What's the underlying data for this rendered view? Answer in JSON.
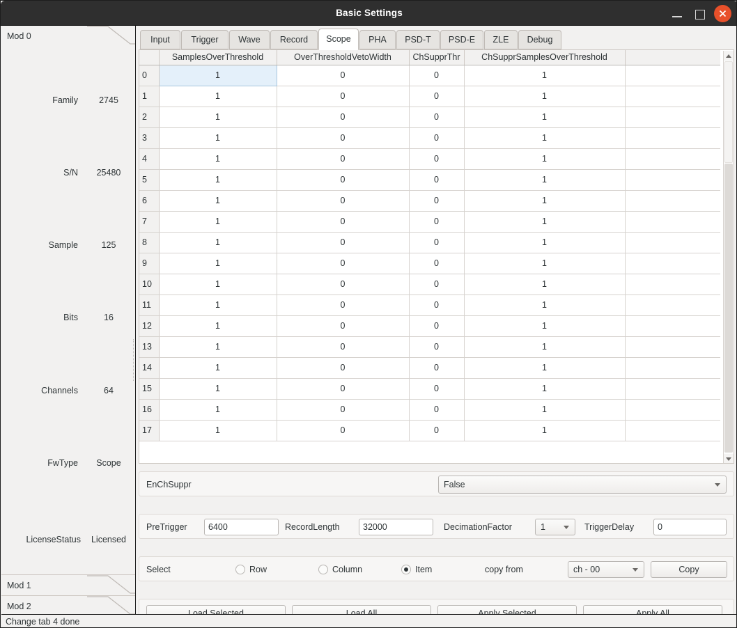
{
  "window": {
    "title": "Basic Settings",
    "buttons": {
      "minimize": "minimize-icon",
      "maximize": "maximize-icon",
      "close": "close-icon"
    },
    "accent_close": "#e8502a"
  },
  "sidebar": {
    "tabs": [
      {
        "label": "Mod 0",
        "active": true
      },
      {
        "label": "Mod 1",
        "active": false
      },
      {
        "label": "Mod 2",
        "active": false
      }
    ],
    "info": [
      {
        "key": "Family",
        "value": "2745"
      },
      {
        "key": "S/N",
        "value": "25480"
      },
      {
        "key": "Sample",
        "value": "125"
      },
      {
        "key": "Bits",
        "value": "16"
      },
      {
        "key": "Channels",
        "value": "64"
      },
      {
        "key": "FwType",
        "value": "Scope"
      },
      {
        "key": "LicenseStatus",
        "value": "Licensed"
      }
    ]
  },
  "statusbar": {
    "text": "Change tab 4 done"
  },
  "tabs": [
    {
      "label": "Input",
      "active": false
    },
    {
      "label": "Trigger",
      "active": false
    },
    {
      "label": "Wave",
      "active": false
    },
    {
      "label": "Record",
      "active": false
    },
    {
      "label": "Scope",
      "active": true
    },
    {
      "label": "PHA",
      "active": false
    },
    {
      "label": "PSD-T",
      "active": false
    },
    {
      "label": "PSD-E",
      "active": false
    },
    {
      "label": "ZLE",
      "active": false
    },
    {
      "label": "Debug",
      "active": false
    }
  ],
  "table": {
    "columns": [
      "SamplesOverThreshold",
      "OverThresholdVetoWidth",
      "ChSupprThr",
      "ChSupprSamplesOverThreshold"
    ],
    "selected_cell": {
      "row": 0,
      "col": 0
    },
    "rows": [
      {
        "index": "0",
        "values": [
          "1",
          "0",
          "0",
          "1"
        ]
      },
      {
        "index": "1",
        "values": [
          "1",
          "0",
          "0",
          "1"
        ]
      },
      {
        "index": "2",
        "values": [
          "1",
          "0",
          "0",
          "1"
        ]
      },
      {
        "index": "3",
        "values": [
          "1",
          "0",
          "0",
          "1"
        ]
      },
      {
        "index": "4",
        "values": [
          "1",
          "0",
          "0",
          "1"
        ]
      },
      {
        "index": "5",
        "values": [
          "1",
          "0",
          "0",
          "1"
        ]
      },
      {
        "index": "6",
        "values": [
          "1",
          "0",
          "0",
          "1"
        ]
      },
      {
        "index": "7",
        "values": [
          "1",
          "0",
          "0",
          "1"
        ]
      },
      {
        "index": "8",
        "values": [
          "1",
          "0",
          "0",
          "1"
        ]
      },
      {
        "index": "9",
        "values": [
          "1",
          "0",
          "0",
          "1"
        ]
      },
      {
        "index": "10",
        "values": [
          "1",
          "0",
          "0",
          "1"
        ]
      },
      {
        "index": "11",
        "values": [
          "1",
          "0",
          "0",
          "1"
        ]
      },
      {
        "index": "12",
        "values": [
          "1",
          "0",
          "0",
          "1"
        ]
      },
      {
        "index": "13",
        "values": [
          "1",
          "0",
          "0",
          "1"
        ]
      },
      {
        "index": "14",
        "values": [
          "1",
          "0",
          "0",
          "1"
        ]
      },
      {
        "index": "15",
        "values": [
          "1",
          "0",
          "0",
          "1"
        ]
      },
      {
        "index": "16",
        "values": [
          "1",
          "0",
          "0",
          "1"
        ]
      },
      {
        "index": "17",
        "values": [
          "1",
          "0",
          "0",
          "1"
        ]
      }
    ]
  },
  "enchsuppr": {
    "label": "EnChSuppr",
    "value": "False"
  },
  "params": {
    "pretrigger_label": "PreTrigger",
    "pretrigger_value": "6400",
    "recordlength_label": "RecordLength",
    "recordlength_value": "32000",
    "decimationfactor_label": "DecimationFactor",
    "decimationfactor_value": "1",
    "triggerdelay_label": "TriggerDelay",
    "triggerdelay_value": "0"
  },
  "selectbar": {
    "select_label": "Select",
    "row_label": "Row",
    "column_label": "Column",
    "item_label": "Item",
    "selected": "Item",
    "copyfrom_label": "copy from",
    "channel_value": "ch - 00",
    "copy_label": "Copy"
  },
  "actions": [
    {
      "label": "Load Selected"
    },
    {
      "label": "Load All"
    },
    {
      "label": "Apply Selected"
    },
    {
      "label": "Apply All"
    }
  ]
}
